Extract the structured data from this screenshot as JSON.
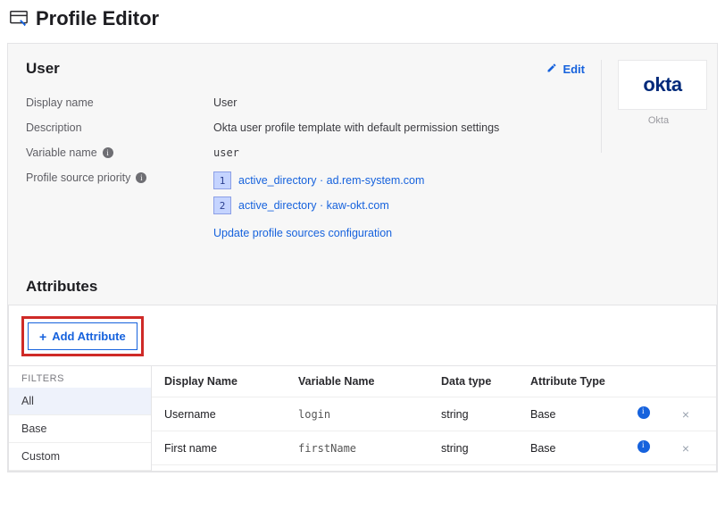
{
  "page_title": "Profile Editor",
  "user": {
    "heading": "User",
    "edit_label": "Edit",
    "fields": {
      "display_name_label": "Display name",
      "display_name_value": "User",
      "description_label": "Description",
      "description_value": "Okta user profile template with default permission settings",
      "variable_name_label": "Variable name",
      "variable_name_value": "user",
      "profile_source_label": "Profile source priority"
    },
    "profile_sources": [
      {
        "order": "1",
        "label": "active_directory · ad.rem-system.com"
      },
      {
        "order": "2",
        "label": "active_directory · kaw-okt.com"
      }
    ],
    "update_sources_label": "Update profile sources configuration"
  },
  "logo": {
    "text": "okta",
    "caption": "Okta"
  },
  "attributes": {
    "heading": "Attributes",
    "add_button_label": "Add Attribute",
    "filters_title": "FILTERS",
    "filters": [
      {
        "label": "All",
        "active": true
      },
      {
        "label": "Base",
        "active": false
      },
      {
        "label": "Custom",
        "active": false
      }
    ],
    "columns": {
      "display_name": "Display Name",
      "variable_name": "Variable Name",
      "data_type": "Data type",
      "attribute_type": "Attribute Type"
    },
    "rows": [
      {
        "display_name": "Username",
        "variable_name": "login",
        "data_type": "string",
        "attribute_type": "Base"
      },
      {
        "display_name": "First name",
        "variable_name": "firstName",
        "data_type": "string",
        "attribute_type": "Base"
      }
    ]
  }
}
